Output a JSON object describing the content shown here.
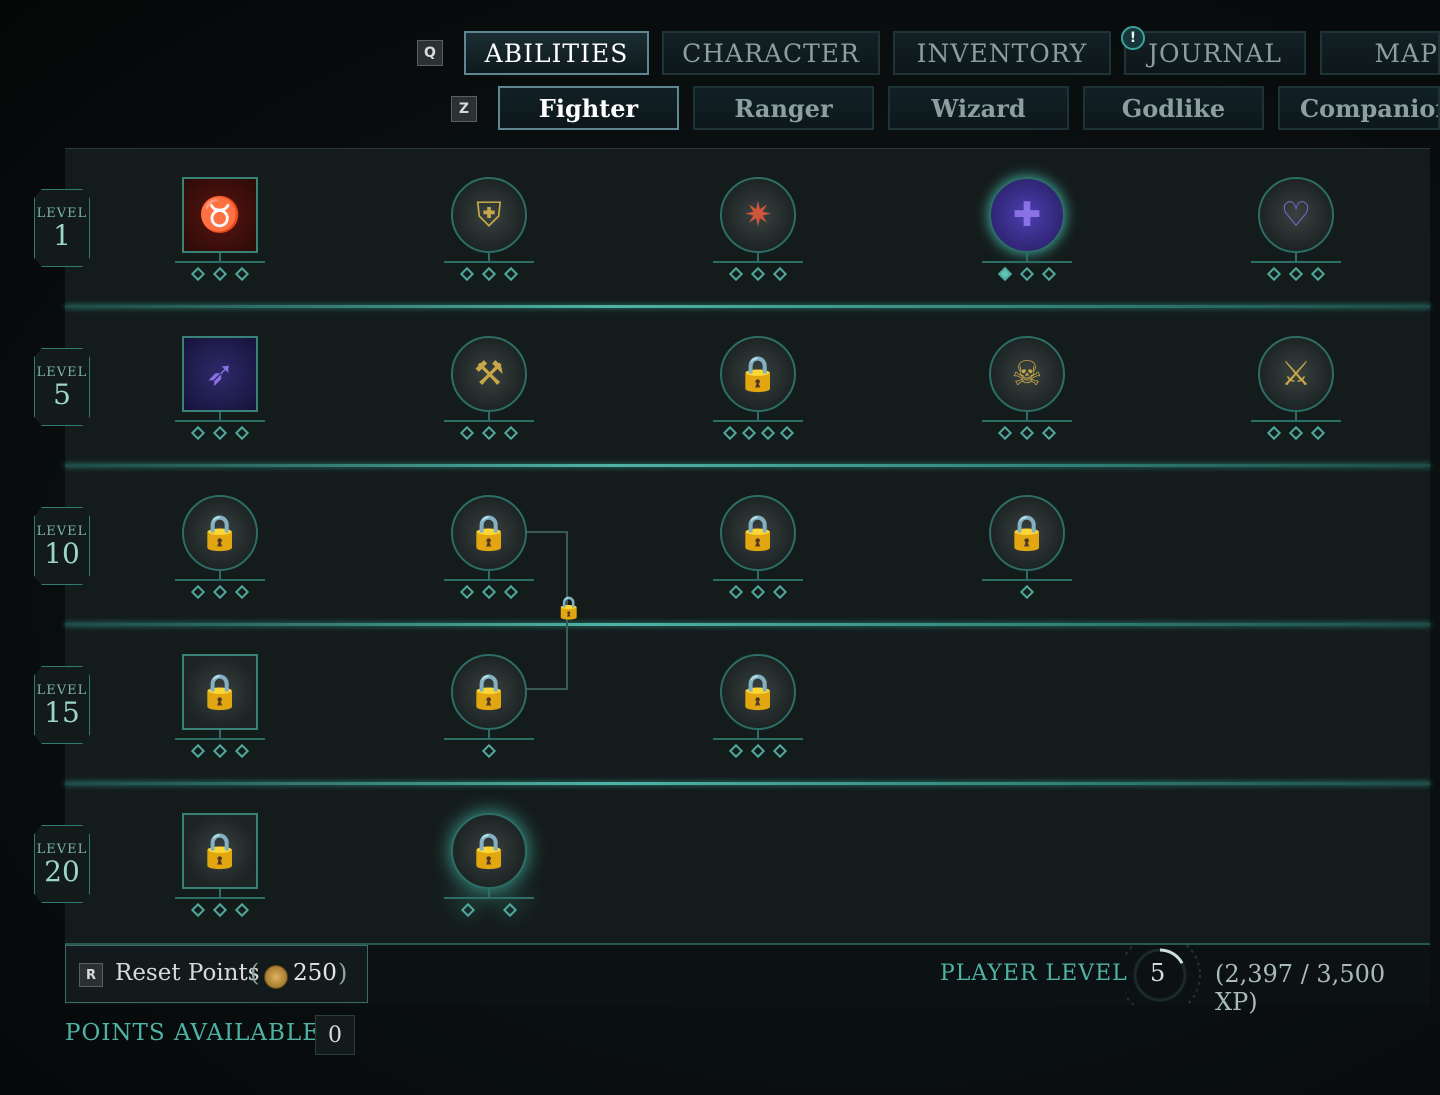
{
  "top_tabs": {
    "key": "Q",
    "items": [
      "ABILITIES",
      "CHARACTER",
      "INVENTORY",
      "JOURNAL",
      "MAP"
    ],
    "active": "ABILITIES",
    "journal_alert": "!"
  },
  "class_tabs": {
    "key": "Z",
    "items": [
      "Fighter",
      "Ranger",
      "Wizard",
      "Godlike",
      "Companions"
    ],
    "active": "Fighter"
  },
  "level_label": "LEVEL",
  "levels": [
    "1",
    "5",
    "10",
    "15",
    "20"
  ],
  "rows": [
    {
      "level": "1",
      "abilities": [
        {
          "icon": "bull-rage-icon",
          "shape": "square",
          "locked": false,
          "upgrades": 3,
          "active_upgrades": 0
        },
        {
          "icon": "shield-burst-icon",
          "shape": "circle",
          "locked": false,
          "upgrades": 3,
          "active_upgrades": 0
        },
        {
          "icon": "shield-bash-icon",
          "shape": "circle",
          "locked": false,
          "upgrades": 3,
          "active_upgrades": 0
        },
        {
          "icon": "healing-crosses-icon",
          "shape": "circle",
          "locked": false,
          "upgrades": 3,
          "active_upgrades": 1
        },
        {
          "icon": "heart-icon",
          "shape": "circle",
          "locked": false,
          "upgrades": 3,
          "active_upgrades": 0
        }
      ]
    },
    {
      "level": "5",
      "abilities": [
        {
          "icon": "dash-strike-icon",
          "shape": "square",
          "locked": false,
          "upgrades": 3,
          "active_upgrades": 0
        },
        {
          "icon": "axe-slam-icon",
          "shape": "circle",
          "locked": false,
          "upgrades": 3,
          "active_upgrades": 0
        },
        {
          "icon": "charge-lock-icon",
          "shape": "circle",
          "locked": true,
          "upgrades": 4,
          "active_upgrades": 0
        },
        {
          "icon": "skull-icon",
          "shape": "circle",
          "locked": false,
          "upgrades": 3,
          "active_upgrades": 0
        },
        {
          "icon": "battle-axe-icon",
          "shape": "circle",
          "locked": false,
          "upgrades": 3,
          "active_upgrades": 0
        }
      ]
    },
    {
      "level": "10",
      "abilities": [
        {
          "icon": "lock-icon",
          "shape": "circle",
          "locked": true,
          "upgrades": 3,
          "active_upgrades": 0
        },
        {
          "icon": "lock-icon",
          "shape": "circle",
          "locked": true,
          "upgrades": 3,
          "active_upgrades": 0
        },
        {
          "icon": "lock-icon",
          "shape": "circle",
          "locked": true,
          "upgrades": 3,
          "active_upgrades": 0
        },
        {
          "icon": "lock-icon",
          "shape": "circle",
          "locked": true,
          "upgrades": 1,
          "active_upgrades": 0
        }
      ]
    },
    {
      "level": "15",
      "abilities": [
        {
          "icon": "lock-icon",
          "shape": "square",
          "locked": true,
          "upgrades": 3,
          "active_upgrades": 0
        },
        {
          "icon": "lock-icon",
          "shape": "circle",
          "locked": true,
          "upgrades": 1,
          "active_upgrades": 0
        },
        {
          "icon": "lock-icon",
          "shape": "circle",
          "locked": true,
          "upgrades": 3,
          "active_upgrades": 0
        }
      ]
    },
    {
      "level": "20",
      "abilities": [
        {
          "icon": "lock-icon",
          "shape": "square",
          "locked": true,
          "upgrades": 3,
          "active_upgrades": 0
        },
        {
          "icon": "lock-icon",
          "shape": "circle",
          "locked": true,
          "upgrades": 2,
          "active_upgrades": 0,
          "highlighted": true
        }
      ]
    }
  ],
  "footer": {
    "reset_key": "R",
    "reset_label": "Reset Points",
    "paren_open": "(",
    "reset_cost": "250",
    "paren_close": ")",
    "player_level_label": "PLAYER LEVEL",
    "player_level": "5",
    "xp": "(2,397 / 3,500 XP)",
    "xp_progress": 0.685
  },
  "points_available_label": "POINTS AVAILABLE",
  "points_available": "0",
  "colors": {
    "accent": "#4fb3a6",
    "lock": "#d38a3a",
    "active_text": "#ffffff",
    "inactive_text": "#8d9ea1"
  }
}
